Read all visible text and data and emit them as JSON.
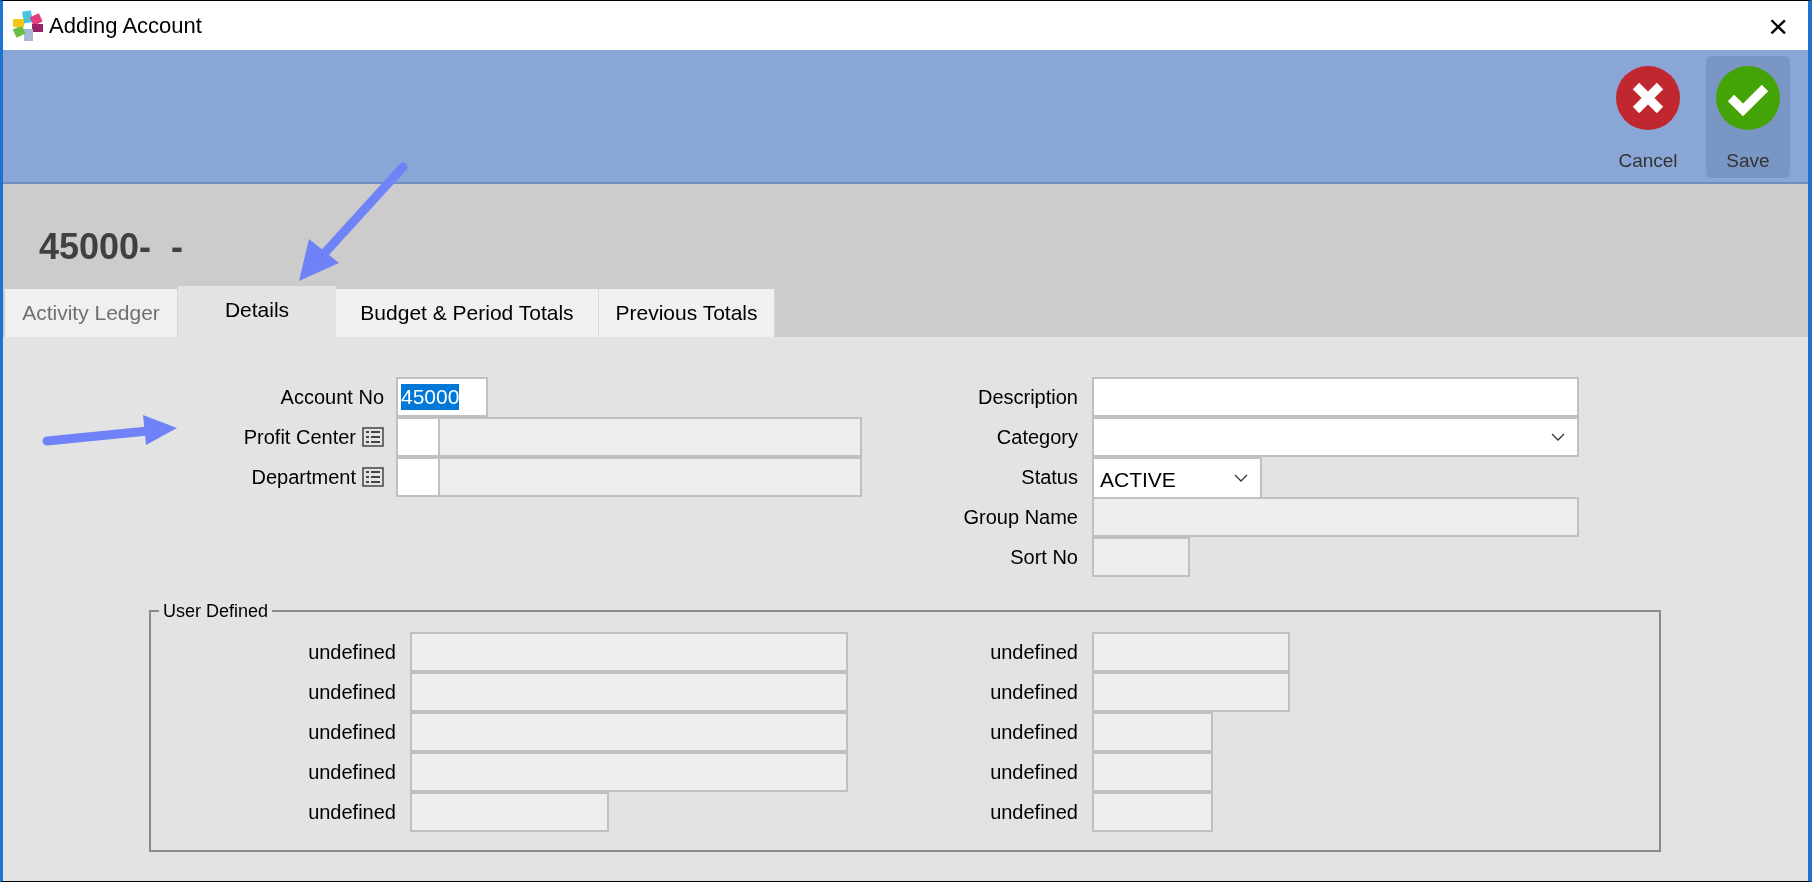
{
  "window": {
    "title": "Adding Account",
    "close": "×"
  },
  "toolbar": [
    {
      "kind": "cancel",
      "label": "Cancel",
      "selected": false
    },
    {
      "kind": "save",
      "label": "Save",
      "selected": true
    }
  ],
  "record_title": "45000-  -",
  "tabs": [
    {
      "label": "Activity Ledger",
      "selected": false
    },
    {
      "label": "Details",
      "selected": true
    },
    {
      "label": "Budget & Period Totals",
      "selected": false
    },
    {
      "label": "Previous Totals",
      "selected": false
    }
  ],
  "left_fields": [
    {
      "label": "Account No",
      "kind": "text",
      "value": "45000"
    },
    {
      "label": "Profit Center",
      "kind": "lookup"
    },
    {
      "label": "Department",
      "kind": "lookup"
    }
  ],
  "right_fields": [
    {
      "label": "Description",
      "kind": "text"
    },
    {
      "label": "Category",
      "kind": "dropdown"
    },
    {
      "label": "Status",
      "kind": "dropdown_short",
      "value": "ACTIVE"
    },
    {
      "label": "Group Name",
      "kind": "readonly"
    },
    {
      "label": "Sort No",
      "kind": "readonly_short"
    }
  ],
  "user_defined": {
    "legend": "User Defined",
    "left": [
      {
        "label": "undefined",
        "kind": "wide"
      },
      {
        "label": "undefined",
        "kind": "wide"
      },
      {
        "label": "undefined",
        "kind": "wide"
      },
      {
        "label": "undefined",
        "kind": "wide"
      },
      {
        "label": "undefined",
        "kind": "short"
      }
    ],
    "right": [
      {
        "label": "undefined",
        "kind": "medium"
      },
      {
        "label": "undefined",
        "kind": "medium"
      },
      {
        "label": "undefined",
        "kind": "small"
      },
      {
        "label": "undefined",
        "kind": "small"
      },
      {
        "label": "undefined",
        "kind": "small"
      }
    ]
  }
}
